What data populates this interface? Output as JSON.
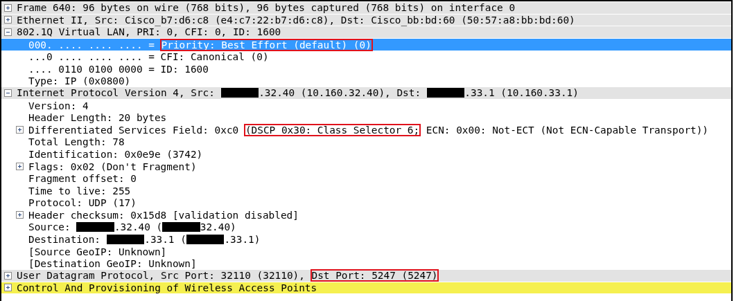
{
  "items": [
    {
      "selected": false,
      "expanded": false,
      "color": "#e3e3e3",
      "parts": [
        {
          "kind": "text",
          "text": "Frame 640: 96 bytes on wire (768 bits), 96 bytes captured (768 bits) on interface 0"
        }
      ]
    },
    {
      "selected": false,
      "expanded": false,
      "color": "#e3e3e3",
      "parts": [
        {
          "kind": "text",
          "text": "Ethernet II, Src: Cisco_b7:d6:c8 (e4:c7:22:b7:d6:c8), Dst: Cisco_bb:bd:60 (50:57:a8:bb:bd:60)"
        }
      ]
    },
    {
      "selected": false,
      "expanded": true,
      "color": "#e3e3e3",
      "parts": [
        {
          "kind": "text",
          "text": "802.1Q Virtual LAN, PRI: 0, CFI: 0, ID: 1600"
        }
      ],
      "children": [
        {
          "selected": true,
          "parts": [
            {
              "kind": "text",
              "text": "000. .... .... .... = "
            },
            {
              "kind": "marked",
              "text": "Priority: Best Effort (default) (0)"
            }
          ]
        },
        {
          "selected": false,
          "parts": [
            {
              "kind": "text",
              "text": "...0 .... .... .... = CFI: Canonical (0)"
            }
          ]
        },
        {
          "selected": false,
          "parts": [
            {
              "kind": "text",
              "text": ".... 0110 0100 0000 = ID: 1600"
            }
          ]
        },
        {
          "selected": false,
          "parts": [
            {
              "kind": "text",
              "text": "Type: IP (0x0800)"
            }
          ]
        }
      ]
    },
    {
      "selected": false,
      "expanded": true,
      "color": "#e3e3e3",
      "parts": [
        {
          "kind": "text",
          "text": "Internet Protocol Version 4, Src: "
        },
        {
          "kind": "redacted"
        },
        {
          "kind": "text",
          "text": ".32.40 (10.160.32.40), Dst: "
        },
        {
          "kind": "redacted"
        },
        {
          "kind": "text",
          "text": ".33.1 (10.160.33.1)"
        }
      ],
      "children": [
        {
          "selected": false,
          "parts": [
            {
              "kind": "text",
              "text": "Version: 4"
            }
          ]
        },
        {
          "selected": false,
          "parts": [
            {
              "kind": "text",
              "text": "Header Length: 20 bytes"
            }
          ]
        },
        {
          "selected": false,
          "expanded": false,
          "parts": [
            {
              "kind": "text",
              "text": "Differentiated Services Field: 0xc0 "
            },
            {
              "kind": "marked",
              "text": "(DSCP 0x30: Class Selector 6;"
            },
            {
              "kind": "text",
              "text": " ECN: 0x00: Not-ECT (Not ECN-Capable Transport))"
            }
          ]
        },
        {
          "selected": false,
          "parts": [
            {
              "kind": "text",
              "text": "Total Length: 78"
            }
          ]
        },
        {
          "selected": false,
          "parts": [
            {
              "kind": "text",
              "text": "Identification: 0x0e9e (3742)"
            }
          ]
        },
        {
          "selected": false,
          "expanded": false,
          "parts": [
            {
              "kind": "text",
              "text": "Flags: 0x02 (Don't Fragment)"
            }
          ]
        },
        {
          "selected": false,
          "parts": [
            {
              "kind": "text",
              "text": "Fragment offset: 0"
            }
          ]
        },
        {
          "selected": false,
          "parts": [
            {
              "kind": "text",
              "text": "Time to live: 255"
            }
          ]
        },
        {
          "selected": false,
          "parts": [
            {
              "kind": "text",
              "text": "Protocol: UDP (17)"
            }
          ]
        },
        {
          "selected": false,
          "expanded": false,
          "parts": [
            {
              "kind": "text",
              "text": "Header checksum: 0x15d8 [validation disabled]"
            }
          ]
        },
        {
          "selected": false,
          "parts": [
            {
              "kind": "text",
              "text": "Source: "
            },
            {
              "kind": "redacted"
            },
            {
              "kind": "text",
              "text": ".32.40 ("
            },
            {
              "kind": "redacted"
            },
            {
              "kind": "text",
              "text": "32.40)"
            }
          ]
        },
        {
          "selected": false,
          "parts": [
            {
              "kind": "text",
              "text": "Destination: "
            },
            {
              "kind": "redacted"
            },
            {
              "kind": "text",
              "text": ".33.1 ("
            },
            {
              "kind": "redacted"
            },
            {
              "kind": "text",
              "text": ".33.1)"
            }
          ]
        },
        {
          "selected": false,
          "parts": [
            {
              "kind": "text",
              "text": "[Source GeoIP: Unknown]"
            }
          ]
        },
        {
          "selected": false,
          "parts": [
            {
              "kind": "text",
              "text": "[Destination GeoIP: Unknown]"
            }
          ]
        }
      ]
    },
    {
      "selected": false,
      "expanded": false,
      "color": "#e3e3e3",
      "parts": [
        {
          "kind": "text",
          "text": "User Datagram Protocol, Src Port: 32110 (32110), "
        },
        {
          "kind": "marked",
          "text": "Dst Port: 5247 (5247)"
        }
      ]
    },
    {
      "selected": false,
      "expanded": false,
      "color": "#f5f050",
      "parts": [
        {
          "kind": "text",
          "text": "Control And Provisioning of Wireless Access Points"
        }
      ]
    }
  ]
}
